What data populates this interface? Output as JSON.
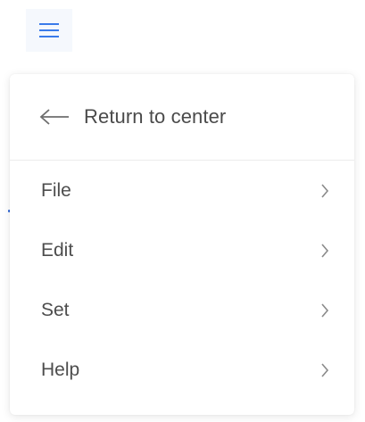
{
  "colors": {
    "accent": "#3a7bea",
    "text": "#4d4d4d",
    "icon": "#8a8a8a"
  },
  "toggle": {
    "icon": "hamburger-menu-icon"
  },
  "menu": {
    "back_label": "Return to center",
    "back_icon": "arrow-left-icon",
    "items": [
      {
        "label": "File",
        "icon": "chevron-right-icon"
      },
      {
        "label": "Edit",
        "icon": "chevron-right-icon"
      },
      {
        "label": "Set",
        "icon": "chevron-right-icon"
      },
      {
        "label": "Help",
        "icon": "chevron-right-icon"
      }
    ]
  }
}
